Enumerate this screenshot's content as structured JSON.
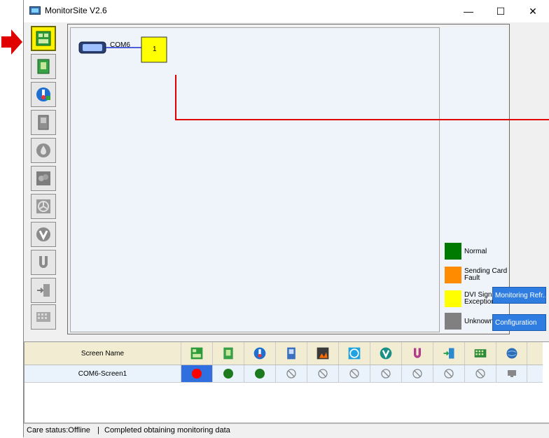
{
  "window": {
    "title": "MonitorSite V2.6",
    "controls": {
      "minimize": "—",
      "maximize": "☐",
      "close": "✕"
    }
  },
  "sidebar": {
    "items": [
      {
        "name": "receiving-card",
        "active": true
      },
      {
        "name": "module"
      },
      {
        "name": "temperature"
      },
      {
        "name": "cabinet-door"
      },
      {
        "name": "humidity"
      },
      {
        "name": "smoke"
      },
      {
        "name": "fan"
      },
      {
        "name": "voltage"
      },
      {
        "name": "magnet"
      },
      {
        "name": "exit"
      },
      {
        "name": "grid"
      }
    ]
  },
  "topology": {
    "port_label": "COM6",
    "screen_box_label": "1"
  },
  "legend": [
    {
      "label": "Normal",
      "color": "#007a00"
    },
    {
      "label": "Sending Card\nFault",
      "color": "#ff8c00"
    },
    {
      "label": "DVI Signal\nException",
      "color": "#ffff00"
    },
    {
      "label": "Unknown",
      "color": "#808080"
    }
  ],
  "buttons": {
    "monitoring_refresh": "Monitoring Refr...",
    "configuration": "Configuration"
  },
  "table": {
    "header_name": "Screen Name",
    "rows": [
      {
        "name": "COM6-Screen1"
      }
    ]
  },
  "status": {
    "care_status": "Care status:Offline",
    "separator": "|",
    "message": "Completed obtaining monitoring data"
  },
  "colors": {
    "accent_blue": "#2f7de1",
    "red_line": "#e00000",
    "status_ok": "#1e7a1e",
    "status_error": "#ff0000"
  }
}
